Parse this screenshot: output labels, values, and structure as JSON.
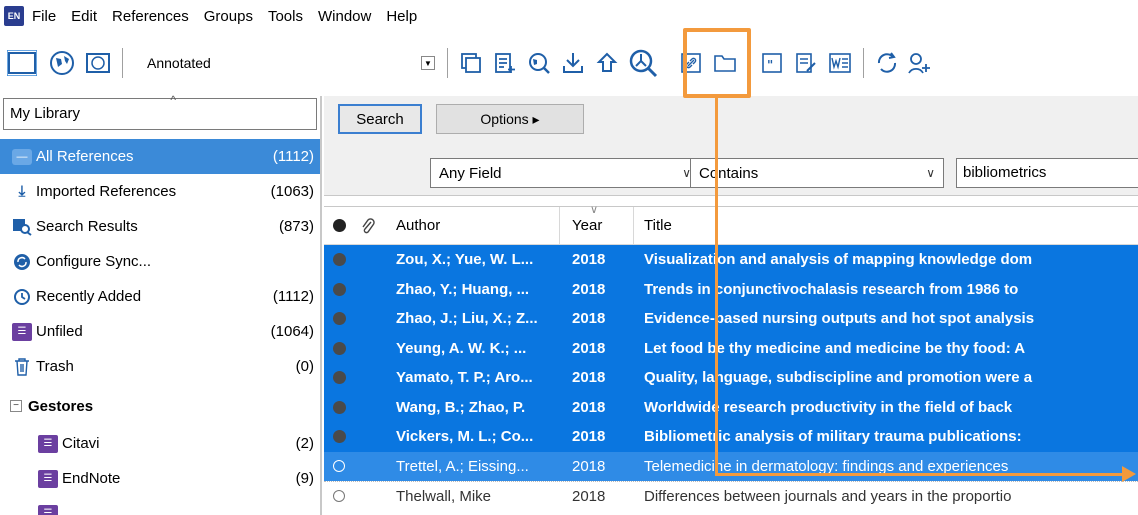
{
  "menubar": {
    "logo": "EN",
    "items": [
      "File",
      "Edit",
      "References",
      "Groups",
      "Tools",
      "Window",
      "Help"
    ]
  },
  "toolbar": {
    "group_select": "Annotated"
  },
  "library": {
    "label": "My Library",
    "groups": [
      {
        "name": "All References",
        "count": "(1112)",
        "icon": "all-references-icon"
      },
      {
        "name": "Imported References",
        "count": "(1063)",
        "icon": "import-icon"
      },
      {
        "name": "Search Results",
        "count": "(873)",
        "icon": "search-results-icon"
      },
      {
        "name": "Configure Sync...",
        "count": "",
        "icon": "sync-icon"
      },
      {
        "name": "Recently Added",
        "count": "(1112)",
        "icon": "recent-icon"
      },
      {
        "name": "Unfiled",
        "count": "(1064)",
        "icon": "unfiled-icon"
      },
      {
        "name": "Trash",
        "count": "(0)",
        "icon": "trash-icon"
      }
    ],
    "group_set": {
      "name": "Gestores",
      "expander": "⊟",
      "items": [
        {
          "name": "Citavi",
          "count": "(2)"
        },
        {
          "name": "EndNote",
          "count": "(9)"
        }
      ]
    }
  },
  "search": {
    "search_label": "Search",
    "options_label": "Options ▸",
    "field": "Any Field",
    "operator": "Contains",
    "term": "bibliometrics"
  },
  "table": {
    "headers": {
      "author": "Author",
      "year": "Year",
      "title": "Title"
    },
    "rows": [
      {
        "author": "Zou, X.; Yue, W. L...",
        "year": "2018",
        "title": "Visualization and analysis of mapping knowledge dom",
        "state": "sel"
      },
      {
        "author": "Zhao, Y.; Huang, ...",
        "year": "2018",
        "title": "Trends in conjunctivochalasis research from 1986 to",
        "state": "sel"
      },
      {
        "author": "Zhao, J.; Liu, X.; Z...",
        "year": "2018",
        "title": "Evidence-based nursing outputs and hot spot analysis",
        "state": "sel"
      },
      {
        "author": "Yeung, A. W. K.; ...",
        "year": "2018",
        "title": "Let food be thy medicine and medicine be thy food: A",
        "state": "sel"
      },
      {
        "author": "Yamato, T. P.; Aro...",
        "year": "2018",
        "title": "Quality, language, subdiscipline and promotion were a",
        "state": "sel"
      },
      {
        "author": "Wang, B.; Zhao, P.",
        "year": "2018",
        "title": "Worldwide research productivity in the field of back",
        "state": "sel"
      },
      {
        "author": "Vickers, M. L.; Co...",
        "year": "2018",
        "title": "Bibliometric analysis of military trauma publications:",
        "state": "sel"
      },
      {
        "author": "Trettel, A.; Eissing...",
        "year": "2018",
        "title": "Telemedicine in dermatology: findings and experiences",
        "state": "sel-light"
      },
      {
        "author": "Thelwall, Mike",
        "year": "2018",
        "title": "Differences between journals and years in the proportio",
        "state": "plain"
      }
    ]
  },
  "colors": {
    "selection": "#0a76e0",
    "highlight": "#f39a3d",
    "accent": "#1f5fa8"
  }
}
